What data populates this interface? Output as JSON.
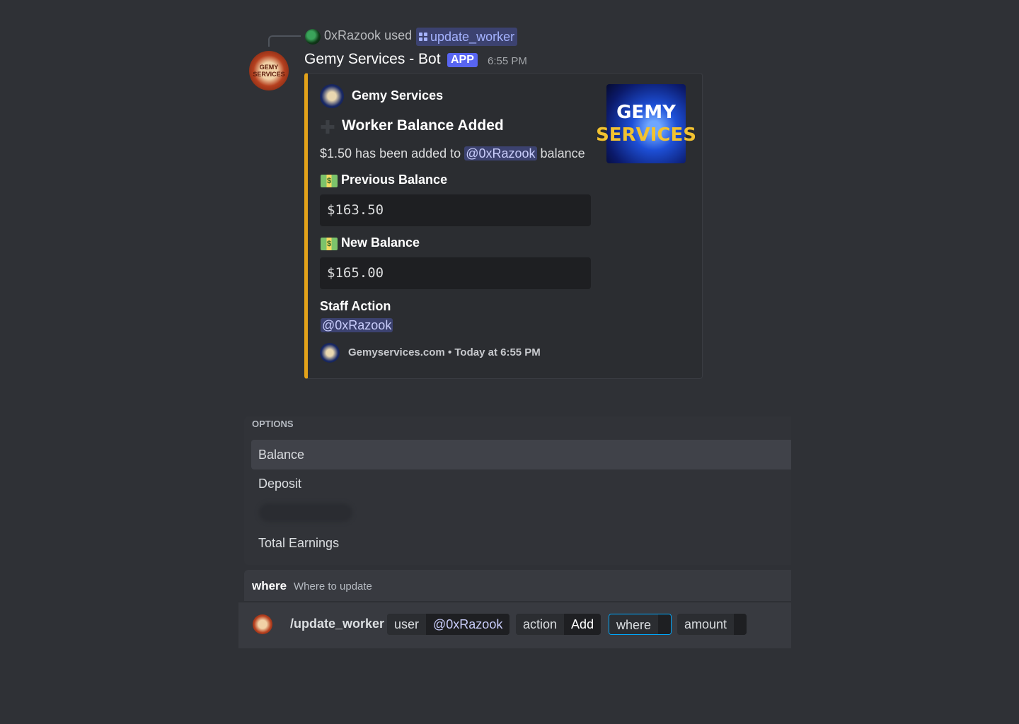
{
  "reply": {
    "user": "0xRazook",
    "used_text": "used",
    "command": "update_worker"
  },
  "message": {
    "author": "Gemy Services - Bot",
    "app_tag": "APP",
    "timestamp": "6:55 PM",
    "bot_avatar_text": "GEMY SERVICES"
  },
  "embed": {
    "accent_color": "#e3a21a",
    "author": "Gemy Services",
    "title": "Worker Balance Added",
    "description_prefix": "$1.50 has been added to",
    "description_mention": "@0xRazook",
    "description_suffix": "balance",
    "fields": [
      {
        "name": "Previous Balance",
        "value": "$163.50"
      },
      {
        "name": "New Balance",
        "value": "$165.00"
      },
      {
        "name": "Staff Action",
        "value": "@0xRazook"
      }
    ],
    "footer_site": "Gemyservices.com",
    "footer_separator": "•",
    "footer_time": "Today at 6:55 PM",
    "thumbnail_line1": "GEMY",
    "thumbnail_line2": "SERVICES"
  },
  "options": {
    "header": "OPTIONS",
    "items": [
      "Balance",
      "Deposit",
      "Total Earnings"
    ],
    "selected": "Balance"
  },
  "param_hint": {
    "name": "where",
    "description": "Where to update"
  },
  "command_bar": {
    "command": "/update_worker",
    "params": [
      {
        "key": "user",
        "value": "@0xRazook"
      },
      {
        "key": "action",
        "value": "Add"
      },
      {
        "key": "where",
        "value": ""
      },
      {
        "key": "amount",
        "value": ""
      }
    ]
  }
}
